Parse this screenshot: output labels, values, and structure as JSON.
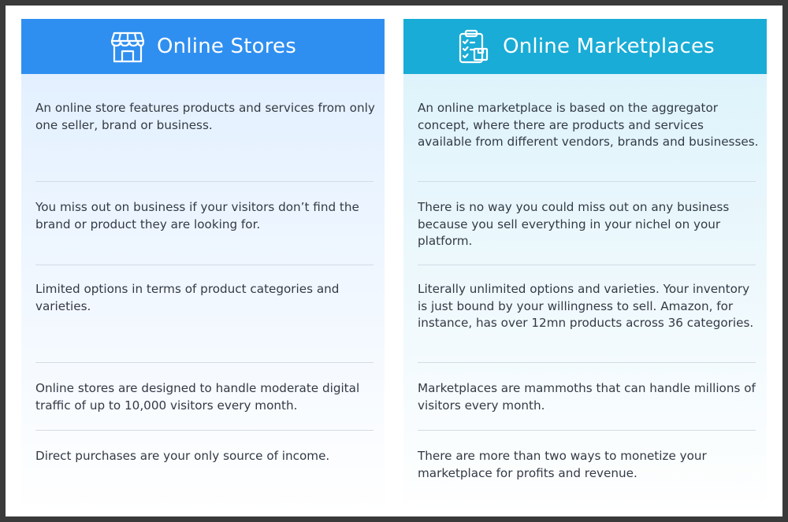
{
  "left": {
    "title": "Online Stores",
    "icon": "storefront-icon",
    "color": "#2f8ff0",
    "rows": [
      "An online store features products and services from only one seller, brand or business.",
      "You miss out on business if your visitors don’t find the brand or product they are looking for.",
      "Limited options in terms of product categories and varieties.",
      "Online stores are designed to handle moderate digital traffic of up to 10,000 visitors every month.",
      "Direct purchases are your only source of income."
    ]
  },
  "right": {
    "title": "Online Marketplaces",
    "icon": "clipboard-checklist-icon",
    "color": "#19acd6",
    "rows": [
      "An online marketplace is based on the aggregator concept, where there are products and services available from different vendors, brands and businesses.",
      "There is no way you could miss out on any business because you sell everything in your nichel on your platform.",
      "Literally unlimited options and varieties. Your inventory is just bound by your willingness to sell. Amazon, for instance, has over 12mn products across 36 categories.",
      "Marketplaces are mammoths that can handle millions of visitors every month.",
      "There are more than two ways to monetize your marketplace for profits and revenue."
    ]
  }
}
